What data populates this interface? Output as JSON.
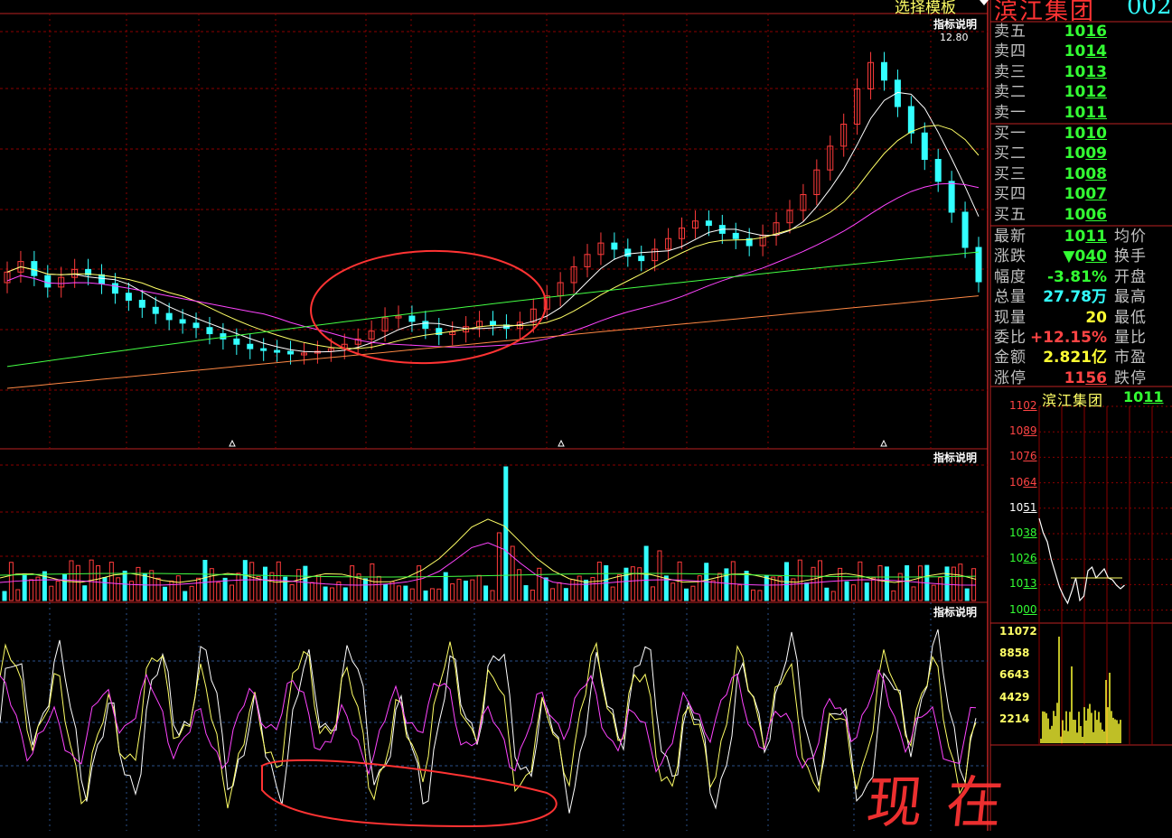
{
  "header": {
    "template_selector": "选择模板",
    "stock_name": "滨江集团",
    "stock_code": "002"
  },
  "indicator_button_label": "指标说明",
  "price_high_label": "12.80",
  "quotes": {
    "asks": [
      {
        "label": "卖五",
        "price": "10.16",
        "int": "10",
        "dec": "16"
      },
      {
        "label": "卖四",
        "price": "10.14",
        "int": "10",
        "dec": "14"
      },
      {
        "label": "卖三",
        "price": "10.13",
        "int": "10",
        "dec": "13"
      },
      {
        "label": "卖二",
        "price": "10.12",
        "int": "10",
        "dec": "12"
      },
      {
        "label": "卖一",
        "price": "10.11",
        "int": "10",
        "dec": "11"
      }
    ],
    "bids": [
      {
        "label": "买一",
        "price": "10.10",
        "int": "10",
        "dec": "10"
      },
      {
        "label": "买二",
        "price": "10.09",
        "int": "10",
        "dec": "09"
      },
      {
        "label": "买三",
        "price": "10.08",
        "int": "10",
        "dec": "08"
      },
      {
        "label": "买四",
        "price": "10.07",
        "int": "10",
        "dec": "07"
      },
      {
        "label": "买五",
        "price": "10.06",
        "int": "10",
        "dec": "06"
      }
    ],
    "stats": [
      {
        "label": "最新",
        "value": "10.11",
        "int": "10",
        "dec": "11",
        "color": "green",
        "label2": "均价"
      },
      {
        "label": "涨跌",
        "value": "▼0.40",
        "int": "▼0",
        "dec": "40",
        "color": "green",
        "label2": "换手"
      },
      {
        "label": "幅度",
        "value": "-3.81%",
        "color": "green",
        "label2": "开盘"
      },
      {
        "label": "总量",
        "value": "27.78万",
        "color": "cyan",
        "label2": "最高"
      },
      {
        "label": "现量",
        "value": "20",
        "color": "yellow",
        "label2": "最低"
      },
      {
        "label": "委比",
        "value": "+12.15%",
        "color": "red",
        "label2": "量比"
      },
      {
        "label": "金额",
        "value": "2.821亿",
        "color": "yellow",
        "label2": "市盈"
      },
      {
        "label": "涨停",
        "value": "11.56",
        "int": "11",
        "dec": "56",
        "color": "red",
        "label2": "跌停"
      }
    ]
  },
  "mini_chart": {
    "title": "滨江集团",
    "last_int": "10",
    "last_dec": "11",
    "price_ticks": [
      {
        "int": "11",
        "dec": "02",
        "color": "#ff4444"
      },
      {
        "int": "10",
        "dec": "89",
        "color": "#ff4444"
      },
      {
        "int": "10",
        "dec": "76",
        "color": "#ff4444"
      },
      {
        "int": "10",
        "dec": "64",
        "color": "#ff4444"
      },
      {
        "int": "10",
        "dec": "51",
        "color": "#ffffff"
      },
      {
        "int": "10",
        "dec": "38",
        "color": "#33ff33"
      },
      {
        "int": "10",
        "dec": "26",
        "color": "#33ff33"
      },
      {
        "int": "10",
        "dec": "13",
        "color": "#33ff33"
      },
      {
        "int": "10",
        "dec": "00",
        "color": "#33ff33"
      }
    ],
    "volume_ticks": [
      "11072",
      "8858",
      "6643",
      "4429",
      "2214"
    ]
  },
  "annotation_text": "现在",
  "colors": {
    "up_candle": "#ff3b3b",
    "down_candle": "#33ffff",
    "ma_white": "#ffffff",
    "ma_yellow": "#ffff66",
    "ma_magenta": "#ff44ff",
    "ma_green": "#44ff44",
    "ma_orange": "#ff8844",
    "grid": "#8b0000",
    "annotation": "#ff3333"
  },
  "chart_data": {
    "type": "candlestick",
    "price_axis_max_label": "12.80",
    "candles_open": [
      10.1,
      10.22,
      10.34,
      10.18,
      10.05,
      10.16,
      10.25,
      10.19,
      10.09,
      9.98,
      9.9,
      9.82,
      9.75,
      9.68,
      9.64,
      9.59,
      9.52,
      9.46,
      9.4,
      9.35,
      9.33,
      9.32,
      9.29,
      9.3,
      9.32,
      9.35,
      9.4,
      9.46,
      9.55,
      9.7,
      9.72,
      9.66,
      9.58,
      9.51,
      9.54,
      9.6,
      9.66,
      9.62,
      9.58,
      9.65,
      9.8,
      9.95,
      10.1,
      10.28,
      10.42,
      10.55,
      10.48,
      10.4,
      10.35,
      10.48,
      10.6,
      10.72,
      10.8,
      10.75,
      10.66,
      10.6,
      10.52,
      10.64,
      10.78,
      10.92,
      11.1,
      11.38,
      11.65,
      11.9,
      12.3,
      12.6,
      12.4,
      12.1,
      11.8,
      11.5,
      11.25,
      10.9,
      10.5
    ],
    "candles_close": [
      10.22,
      10.34,
      10.18,
      10.05,
      10.16,
      10.25,
      10.19,
      10.09,
      9.98,
      9.9,
      9.82,
      9.75,
      9.68,
      9.64,
      9.59,
      9.52,
      9.46,
      9.4,
      9.35,
      9.33,
      9.32,
      9.29,
      9.3,
      9.32,
      9.35,
      9.4,
      9.46,
      9.55,
      9.7,
      9.72,
      9.66,
      9.58,
      9.51,
      9.54,
      9.6,
      9.66,
      9.62,
      9.58,
      9.65,
      9.8,
      9.95,
      10.1,
      10.28,
      10.42,
      10.55,
      10.48,
      10.4,
      10.35,
      10.48,
      10.6,
      10.72,
      10.8,
      10.75,
      10.66,
      10.6,
      10.52,
      10.64,
      10.78,
      10.92,
      11.1,
      11.38,
      11.65,
      11.9,
      12.3,
      12.6,
      12.4,
      12.1,
      11.8,
      11.5,
      11.25,
      10.9,
      10.5,
      10.11
    ]
  }
}
